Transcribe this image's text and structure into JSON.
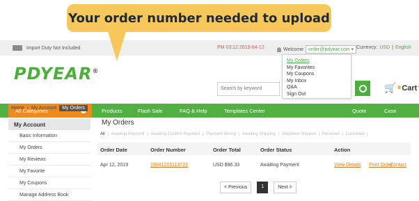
{
  "callout": {
    "text": "Your order number needed to upload"
  },
  "topbar": {
    "import_duty": "Import Duty Not Included",
    "time": "PM 03:12 2019-04-12",
    "welcome": "Welcome",
    "email": "order@pdyear.com",
    "currency_label": "Currency:",
    "currency": "USD",
    "language": "English"
  },
  "header": {
    "logo": "PDYEAR",
    "search_placeholder": "Search by keyword",
    "cart_label": "Cart",
    "cart_count": "0"
  },
  "dropdown": {
    "items": [
      "My Orders",
      "My Favorites",
      "My Coupons",
      "My Inbox",
      "Q&A",
      "Sign Out"
    ]
  },
  "nav": {
    "categories": "All Categories",
    "items": [
      "Products",
      "Flash Sale",
      "FAQ & Help",
      "Templates Center",
      "Quote",
      "Case"
    ]
  },
  "breadcrumb": {
    "home": "Home",
    "account": "My Account",
    "current": "My Orders"
  },
  "sidebar": {
    "title": "My Account",
    "items": [
      "Basic Information",
      "My Orders",
      "My Reviews",
      "My Favorite",
      "My Coupons",
      "Manage Address Book"
    ]
  },
  "main": {
    "title": "My Orders",
    "tabs": [
      "All",
      "Awaiting Payment",
      "Awaiting Confirm Payment",
      "Payment Wrong",
      "Awaiting Shipping",
      "Shipment Shipped",
      "Received",
      "Cancelled"
    ],
    "columns": [
      "Order Date",
      "Order Number",
      "Order Total",
      "Order Status",
      "Action"
    ],
    "rows": [
      {
        "date": "Apr 12, 2019",
        "number": "19041215113722",
        "total": "USD $96.33",
        "status": "Awaiting Payment",
        "actions": [
          "View Details",
          "Print Order",
          "Contact"
        ]
      }
    ],
    "pager": {
      "prev": "< Previous",
      "page": "1",
      "next": "Next >"
    }
  },
  "colors": {
    "brand_green": "#52b043",
    "accent_orange": "#f08a1c",
    "callout_yellow": "#f6c75a"
  }
}
